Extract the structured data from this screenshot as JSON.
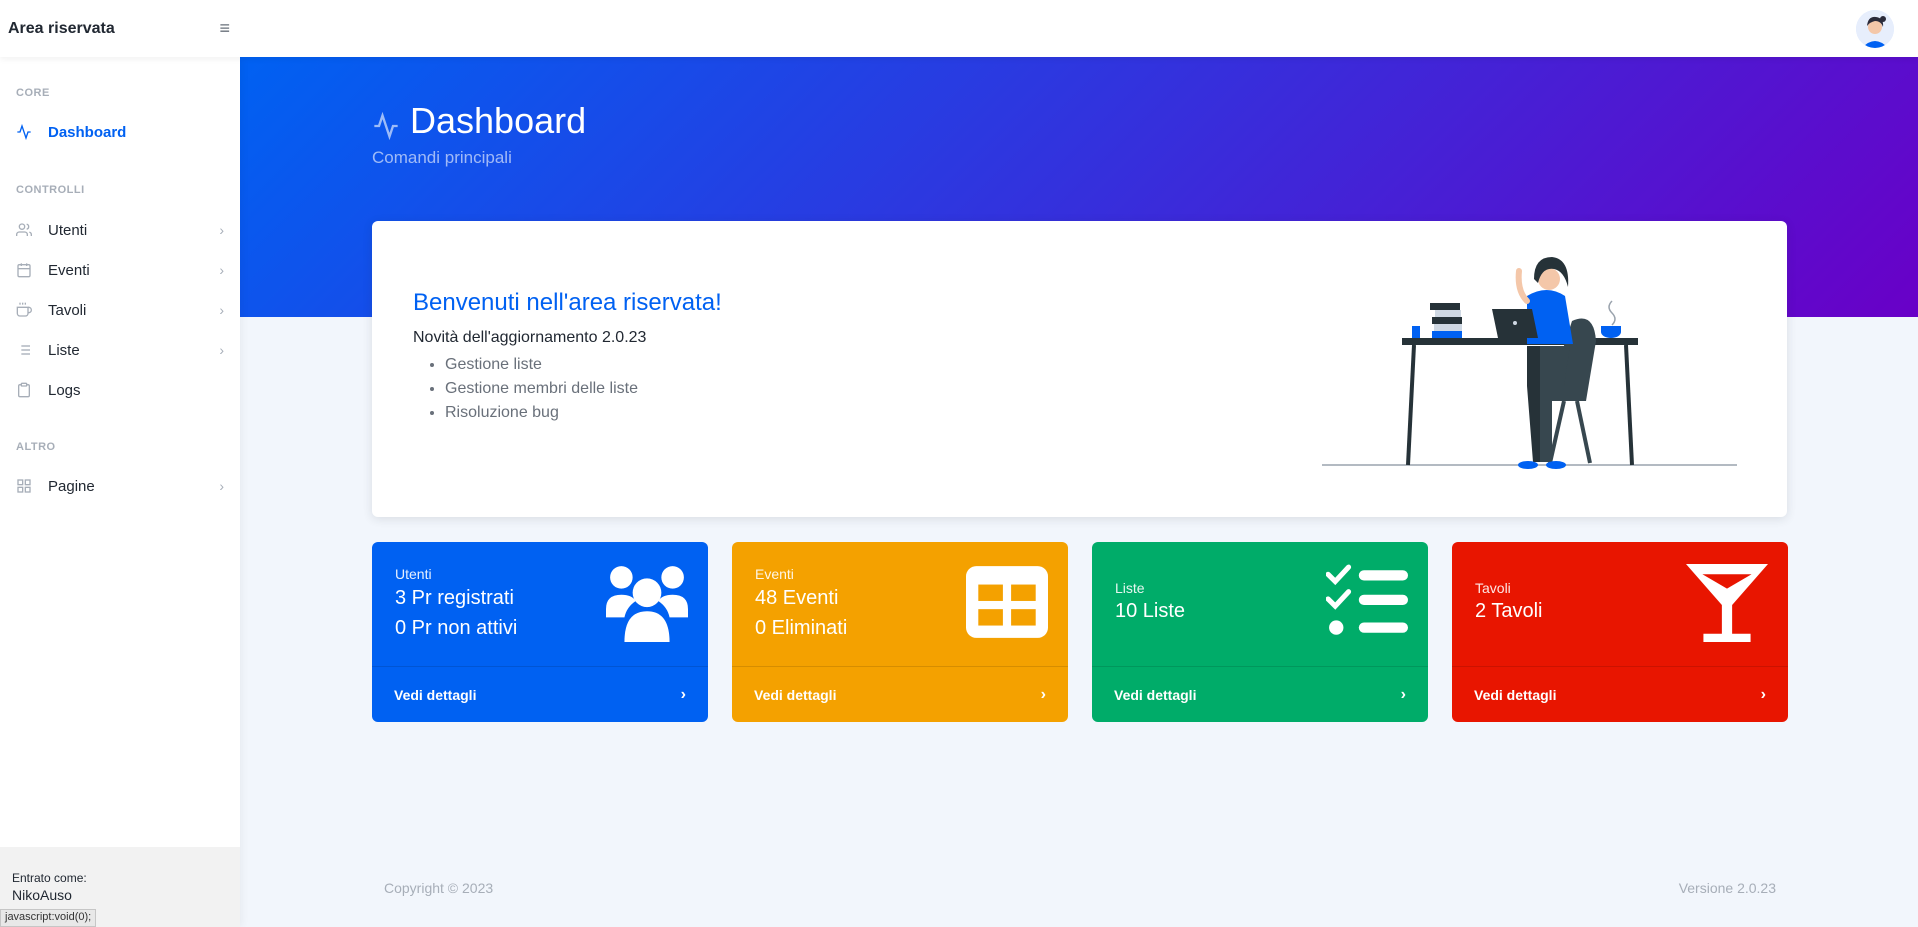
{
  "topnav": {
    "brand": "Area riservata",
    "menu_icon": "hamburger-icon",
    "avatar_icon": "user-avatar"
  },
  "sidebar": {
    "sections": [
      {
        "heading": "CORE",
        "items": [
          {
            "label": "Dashboard",
            "icon": "activity-icon",
            "active": true
          }
        ]
      },
      {
        "heading": "CONTROLLI",
        "items": [
          {
            "label": "Utenti",
            "icon": "users-icon",
            "chevron": true
          },
          {
            "label": "Eventi",
            "icon": "calendar-icon",
            "chevron": true
          },
          {
            "label": "Tavoli",
            "icon": "coffee-icon",
            "chevron": true
          },
          {
            "label": "Liste",
            "icon": "list-icon",
            "chevron": true
          },
          {
            "label": "Logs",
            "icon": "clipboard-icon",
            "chevron": false
          }
        ]
      },
      {
        "heading": "ALTRO",
        "items": [
          {
            "label": "Pagine",
            "icon": "grid-icon",
            "chevron": true
          }
        ]
      }
    ],
    "footer": {
      "subtitle": "Entrato come:",
      "user": "NikoAuso"
    },
    "statusbar": "javascript:void(0);"
  },
  "header": {
    "title": "Dashboard",
    "subtitle": "Comandi principali"
  },
  "welcome": {
    "title": "Benvenuti nell'area riservata!",
    "subtitle": "Novità dell'aggiornamento 2.0.23",
    "items": [
      "Gestione liste",
      "Gestione membri delle liste",
      "Risoluzione bug"
    ]
  },
  "cards": [
    {
      "label": "Utenti",
      "lines": [
        "3 Pr registrati",
        "0 Pr non attivi"
      ],
      "link": "Vedi dettagli",
      "color": "#0061f2",
      "icon": "users-icon"
    },
    {
      "label": "Eventi",
      "lines": [
        "48 Eventi",
        "0 Eliminati"
      ],
      "link": "Vedi dettagli",
      "color": "#f4a100",
      "icon": "table-icon"
    },
    {
      "label": "Liste",
      "lines": [
        "10 Liste"
      ],
      "link": "Vedi dettagli",
      "color": "#00ac69",
      "icon": "list-check-icon"
    },
    {
      "label": "Tavoli",
      "lines": [
        "2 Tavoli"
      ],
      "link": "Vedi dettagli",
      "color": "#e81500",
      "icon": "cocktail-icon"
    }
  ],
  "footer": {
    "copyright": "Copyright © 2023",
    "version": "Versione 2.0.23"
  }
}
